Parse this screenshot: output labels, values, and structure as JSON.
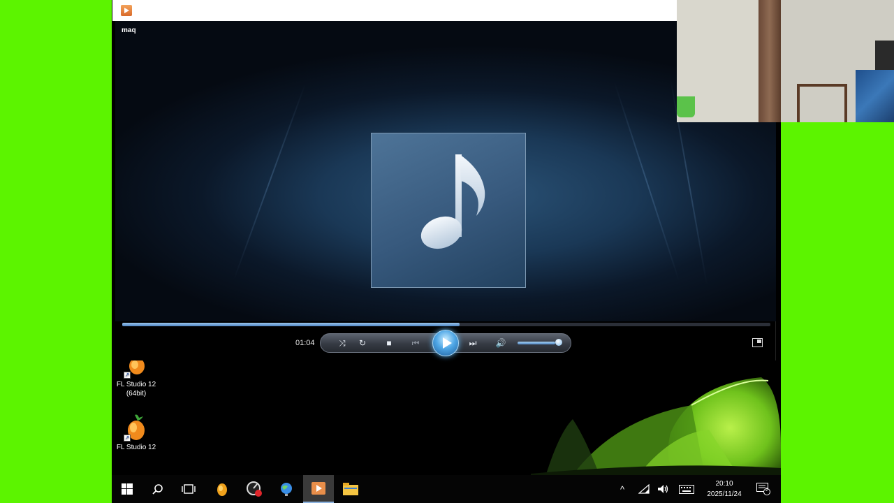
{
  "player": {
    "track_name": "maq",
    "elapsed": "01:04",
    "progress_fraction": 0.52,
    "volume_fraction": 0.9,
    "accent_color": "#4f86c3"
  },
  "controls": {
    "shuffle_icon": "shuffle-icon",
    "repeat_icon": "repeat-icon",
    "stop_icon": "stop-icon",
    "previous_icon": "previous-icon",
    "play_icon": "play-icon",
    "next_icon": "next-icon",
    "mute_icon": "speaker-icon",
    "switch_view_icon": "switch-to-library-icon"
  },
  "desktop": {
    "icons": [
      {
        "label_line1": "FL Studio 12",
        "label_line2": "(64bit)"
      },
      {
        "label_line1": "FL Studio 12",
        "label_line2": ""
      }
    ]
  },
  "taskbar": {
    "items": [
      "start-icon",
      "search-icon",
      "task-view-icon",
      "fl-studio-icon",
      "audio-app-icon",
      "globe-icon",
      "media-player-icon",
      "file-explorer-icon"
    ],
    "clock_time": "20:10",
    "clock_date": "2025/11/24",
    "notification_count": "2"
  }
}
